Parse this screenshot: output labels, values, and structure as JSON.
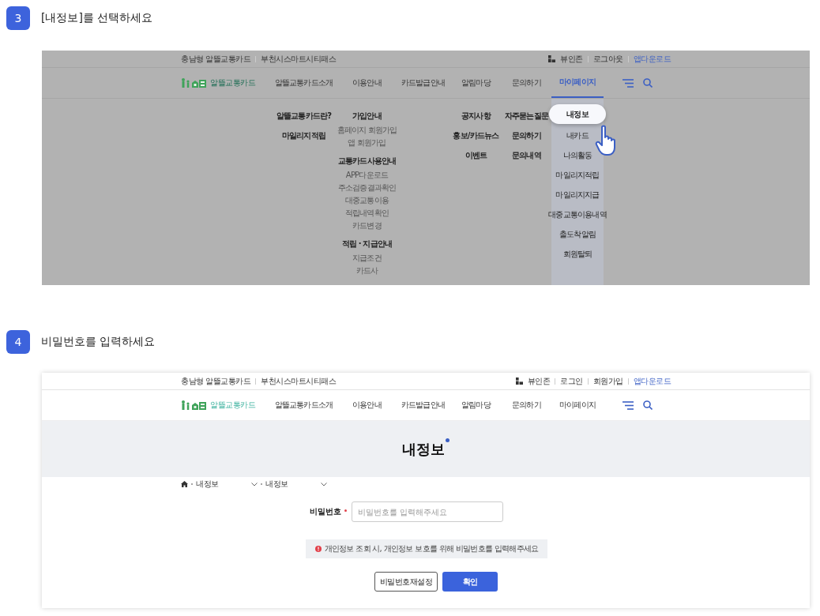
{
  "steps": [
    {
      "number": "3",
      "instruction": "[내정보]를 선택하세요"
    },
    {
      "number": "4",
      "instruction": "비밀번호를 입력하세요"
    }
  ],
  "screenshot_menu": {
    "dimmed": true,
    "utility_left": [
      "충남형 알뜰교통카드",
      "부천시스마트시티패스"
    ],
    "utility_right": [
      {
        "label": "뷰인존",
        "kind": "zone"
      },
      {
        "label": "로그아웃",
        "kind": "text"
      },
      {
        "label": "앱다운로드",
        "kind": "accent"
      }
    ],
    "logo_text": "알뜰교통카드",
    "nav": [
      {
        "label": "알뜰교통카드소개",
        "selected": false,
        "submenu": [
          {
            "label": "알뜰교통카드란?",
            "kind": "heading"
          },
          {
            "label": "마일리지적립",
            "kind": "heading"
          }
        ]
      },
      {
        "label": "이용안내",
        "selected": false,
        "submenu": [
          {
            "label": "가입안내",
            "kind": "heading"
          },
          {
            "label": "홈페이지 회원가입",
            "kind": "link"
          },
          {
            "label": "앱 회원가입",
            "kind": "link"
          },
          {
            "label": "교통카드사용안내",
            "kind": "heading"
          },
          {
            "label": "APP다운로드",
            "kind": "link"
          },
          {
            "label": "주소검증결과확인",
            "kind": "link"
          },
          {
            "label": "대중교통이용",
            "kind": "link"
          },
          {
            "label": "적립내역확인",
            "kind": "link"
          },
          {
            "label": "카드변경",
            "kind": "link"
          },
          {
            "label": "적립 · 지급안내",
            "kind": "heading"
          },
          {
            "label": "지급조건",
            "kind": "link"
          },
          {
            "label": "카드사",
            "kind": "link"
          }
        ]
      },
      {
        "label": "카드발급안내",
        "selected": false
      },
      {
        "label": "알림마당",
        "selected": false,
        "submenu": [
          {
            "label": "공지사항",
            "kind": "heading"
          },
          {
            "label": "홍보/카드뉴스",
            "kind": "heading"
          },
          {
            "label": "이벤트",
            "kind": "heading"
          }
        ]
      },
      {
        "label": "문의하기",
        "selected": false,
        "submenu": [
          {
            "label": "자주묻는질문",
            "kind": "heading"
          },
          {
            "label": "문의하기",
            "kind": "heading"
          },
          {
            "label": "문의내역",
            "kind": "heading"
          }
        ]
      },
      {
        "label": "마이페이지",
        "selected": true,
        "submenu": [
          {
            "label": "내정보",
            "kind": "pill",
            "selected": true
          },
          {
            "label": "내카드",
            "kind": "pill",
            "selected": false
          },
          {
            "label": "나의활동",
            "kind": "pill",
            "selected": false
          },
          {
            "label": "마일리지적립",
            "kind": "pill",
            "selected": false
          },
          {
            "label": "마일리지지급",
            "kind": "pill",
            "selected": false
          },
          {
            "label": "대중교통이용내역",
            "kind": "pill",
            "selected": false
          },
          {
            "label": "출도착알림",
            "kind": "pill",
            "selected": false
          },
          {
            "label": "회원탈퇴",
            "kind": "pill",
            "selected": false
          }
        ]
      }
    ]
  },
  "screenshot_password": {
    "dimmed": false,
    "utility_left": [
      "충남형 알뜰교통카드",
      "부천시스마트시티패스"
    ],
    "utility_right": [
      {
        "label": "뷰인존",
        "kind": "zone"
      },
      {
        "label": "로그인",
        "kind": "text"
      },
      {
        "label": "회원가입",
        "kind": "text"
      },
      {
        "label": "앱다운로드",
        "kind": "accent"
      }
    ],
    "logo_text": "알뜰교통카드",
    "nav": [
      {
        "label": "알뜰교통카드소개",
        "selected": false
      },
      {
        "label": "이용안내",
        "selected": false
      },
      {
        "label": "카드발급안내",
        "selected": false
      },
      {
        "label": "알림마당",
        "selected": false
      },
      {
        "label": "문의하기",
        "selected": false
      },
      {
        "label": "마이페이지",
        "selected": false
      }
    ],
    "page_title": "내정보",
    "breadcrumb": [
      "내정보",
      "내정보"
    ],
    "form": {
      "label": "비밀번호",
      "required": true,
      "placeholder": "비밀번호를 입력해주세요"
    },
    "notice": "개인정보 조회 시, 개인정보 보호를 위해 비밀번호를 입력해주세요",
    "buttons": [
      {
        "label": "비밀번호재설정",
        "kind": "secondary"
      },
      {
        "label": "확인",
        "kind": "primary"
      }
    ]
  }
}
